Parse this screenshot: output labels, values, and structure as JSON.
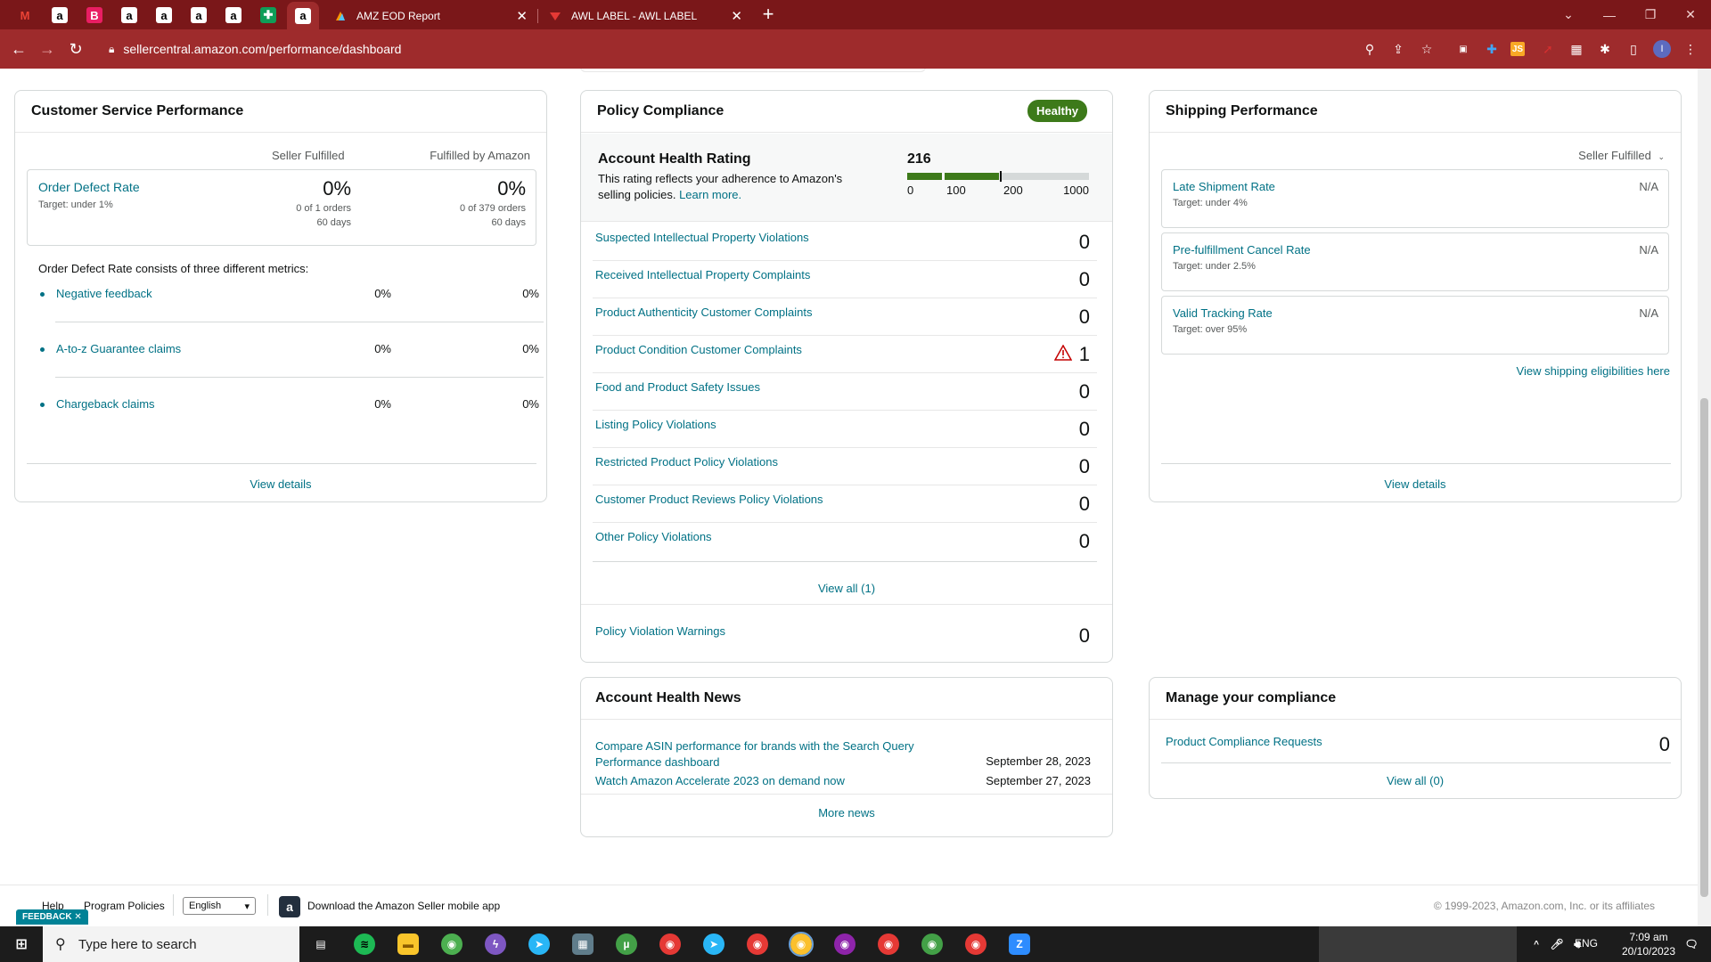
{
  "browser": {
    "tabs": [
      {
        "title": "AMZ EOD Report",
        "close": "✕"
      },
      {
        "title": "AWL LABEL - AWL LABEL",
        "close": "✕"
      }
    ],
    "url": "sellercentral.amazon.com/performance/dashboard"
  },
  "customer_service": {
    "title": "Customer Service Performance",
    "col_seller": "Seller Fulfilled",
    "col_fba": "Fulfilled by Amazon",
    "odr": {
      "label": "Order Defect Rate",
      "target": "Target: under 1%",
      "seller_value": "0%",
      "seller_orders": "0 of 1 orders",
      "seller_days": "60 days",
      "fba_value": "0%",
      "fba_orders": "0 of 379 orders",
      "fba_days": "60 days"
    },
    "consists_text": "Order Defect Rate consists of three different metrics:",
    "metrics": [
      {
        "label": "Negative feedback",
        "seller": "0%",
        "fba": "0%"
      },
      {
        "label": "A-to-z Guarantee claims",
        "seller": "0%",
        "fba": "0%"
      },
      {
        "label": "Chargeback claims",
        "seller": "0%",
        "fba": "0%"
      }
    ],
    "view_details": "View details"
  },
  "policy": {
    "title": "Policy Compliance",
    "badge": "Healthy",
    "ahr_title": "Account Health Rating",
    "ahr_desc": "This rating reflects your adherence to Amazon's selling policies.",
    "learn_more": "Learn more.",
    "ahr_value": "216",
    "ahr_fraction": 0.216,
    "scale": [
      "0",
      "100",
      "200",
      "1000"
    ],
    "rows": [
      {
        "label": "Suspected Intellectual Property Violations",
        "value": "0"
      },
      {
        "label": "Received Intellectual Property Complaints",
        "value": "0"
      },
      {
        "label": "Product Authenticity Customer Complaints",
        "value": "0"
      },
      {
        "label": "Product Condition Customer Complaints",
        "value": "1"
      },
      {
        "label": "Food and Product Safety Issues",
        "value": "0"
      },
      {
        "label": "Listing Policy Violations",
        "value": "0"
      },
      {
        "label": "Restricted Product Policy Violations",
        "value": "0"
      },
      {
        "label": "Customer Product Reviews Policy Violations",
        "value": "0"
      },
      {
        "label": "Other Policy Violations",
        "value": "0"
      }
    ],
    "view_all": "View all (1)",
    "warnings_label": "Policy Violation Warnings",
    "warnings_value": "0",
    "accent_green": "#3d7a1a",
    "warning_red": "#c40000"
  },
  "news": {
    "title": "Account Health News",
    "items": [
      {
        "label": "Compare ASIN performance for brands with the Search Query Performance dashboard",
        "date": "September 28, 2023"
      },
      {
        "label": "Watch Amazon Accelerate 2023 on demand now",
        "date": "September 27, 2023"
      }
    ],
    "more": "More news"
  },
  "shipping": {
    "title": "Shipping Performance",
    "filter": "Seller Fulfilled",
    "rows": [
      {
        "label": "Late Shipment Rate",
        "target": "Target: under 4%",
        "value": "N/A"
      },
      {
        "label": "Pre-fulfillment Cancel Rate",
        "target": "Target: under 2.5%",
        "value": "N/A"
      },
      {
        "label": "Valid Tracking Rate",
        "target": "Target: over 95%",
        "value": "N/A"
      }
    ],
    "eligibilities": "View shipping eligibilities here",
    "view_details": "View details"
  },
  "compliance": {
    "title": "Manage your compliance",
    "row_label": "Product Compliance Requests",
    "row_value": "0",
    "view_all": "View all (0)"
  },
  "footer": {
    "help": "Help",
    "program_policies": "Program Policies",
    "language": "English",
    "download_app": "Download the Amazon Seller mobile app",
    "copyright": "© 1999-2023, Amazon.com, Inc. or its affiliates",
    "feedback": "FEEDBACK"
  },
  "taskbar": {
    "search_placeholder": "Type here to search",
    "lang": "ENG",
    "time": "7:09 am",
    "date": "20/10/2023"
  }
}
